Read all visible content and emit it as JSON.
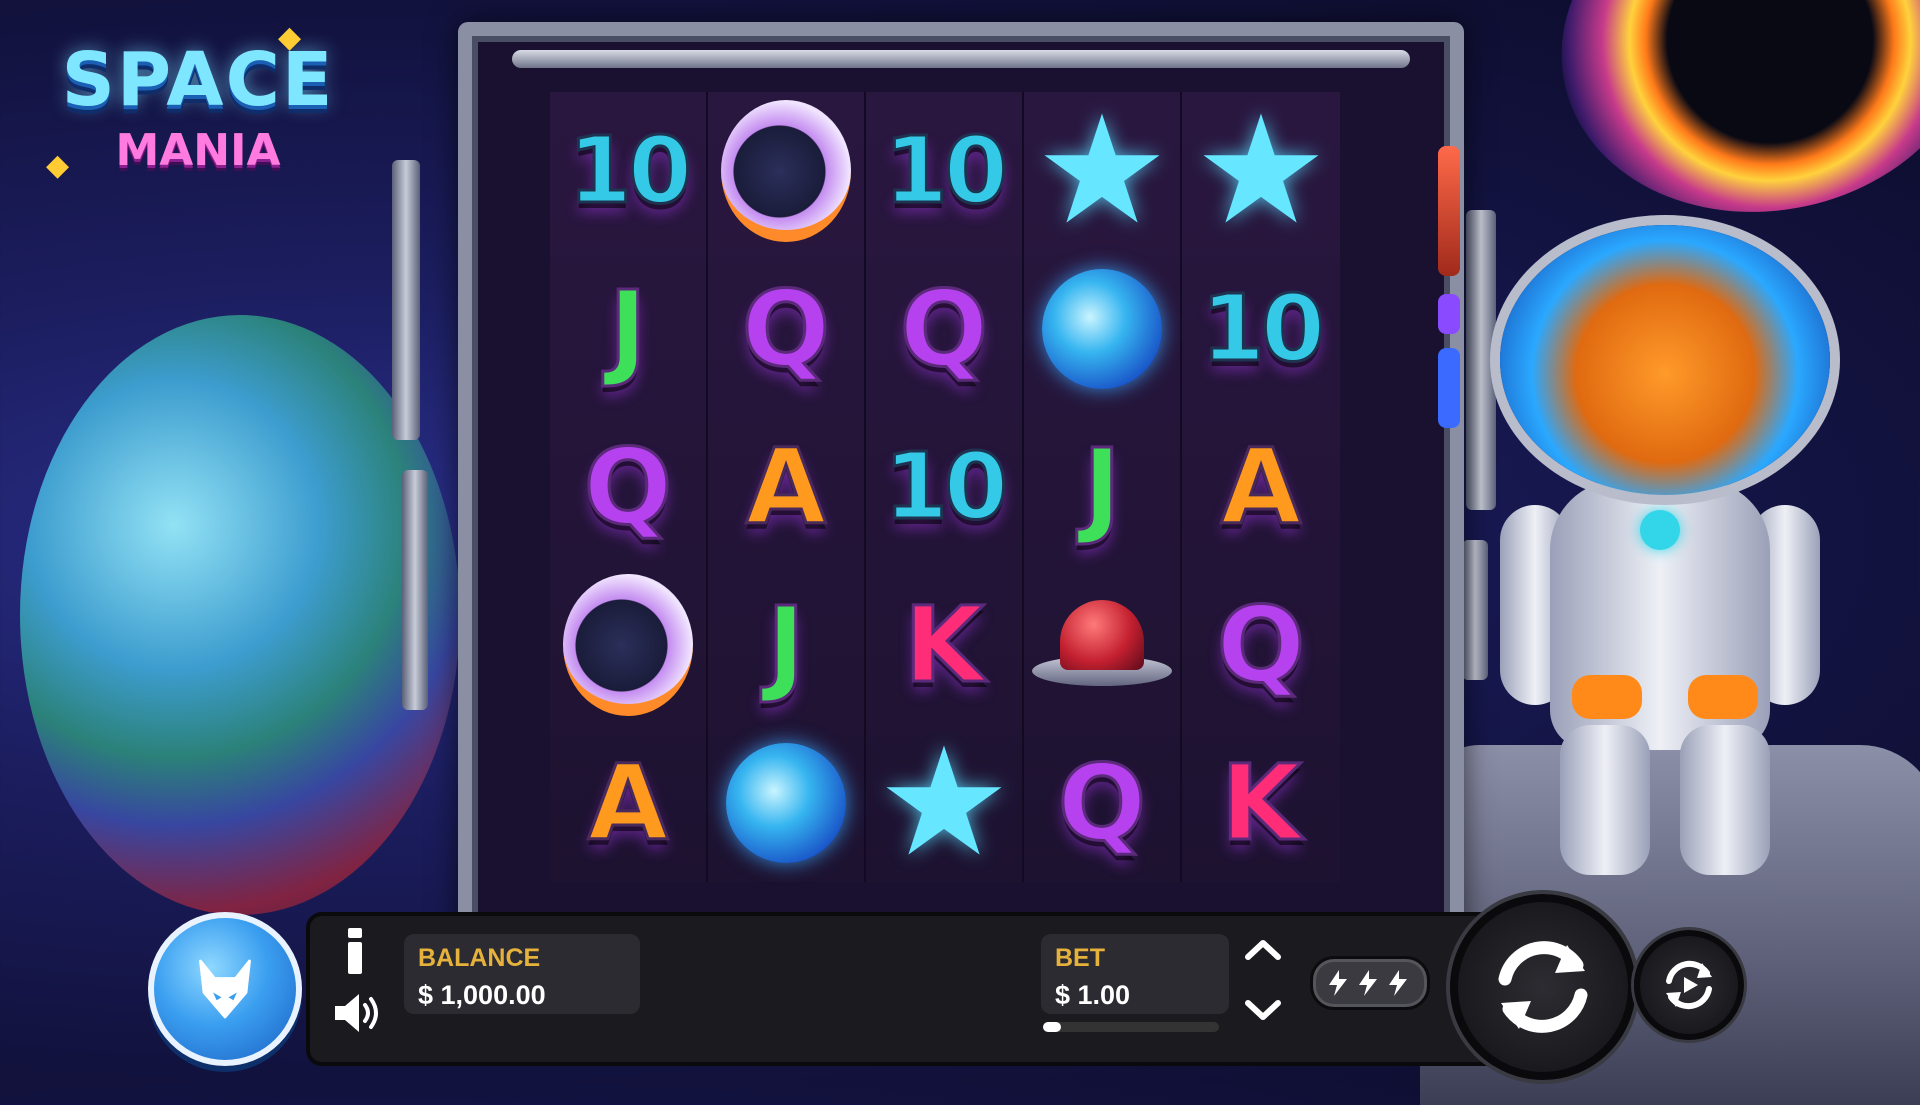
{
  "logo": {
    "line1": "SPACE",
    "line2": "MANIA"
  },
  "reels": [
    [
      "10",
      "helmet",
      "10",
      "star",
      "star"
    ],
    [
      "J",
      "Q",
      "Q",
      "orb",
      "10"
    ],
    [
      "Q",
      "A",
      "10",
      "J",
      "A"
    ],
    [
      "helmet",
      "J",
      "K",
      "dome",
      "Q"
    ],
    [
      "A",
      "orb",
      "star",
      "Q",
      "K"
    ]
  ],
  "controls": {
    "balance_label": "BALANCE",
    "balance_value": "$ 1,000.00",
    "bet_label": "BET",
    "bet_value": "$ 1.00",
    "bet_level": 0.1
  },
  "icons": {
    "menu": "fox-icon",
    "info": "info-icon",
    "sound": "speaker-icon",
    "bet_up": "chevron-up-icon",
    "bet_down": "chevron-down-icon",
    "turbo": "lightning-icon",
    "spin": "refresh-icon",
    "autoplay": "autoplay-icon"
  },
  "colors": {
    "label_accent": "#e6b23c",
    "menu_button": "#3b9ff0",
    "panel": "#1b1b1f"
  }
}
